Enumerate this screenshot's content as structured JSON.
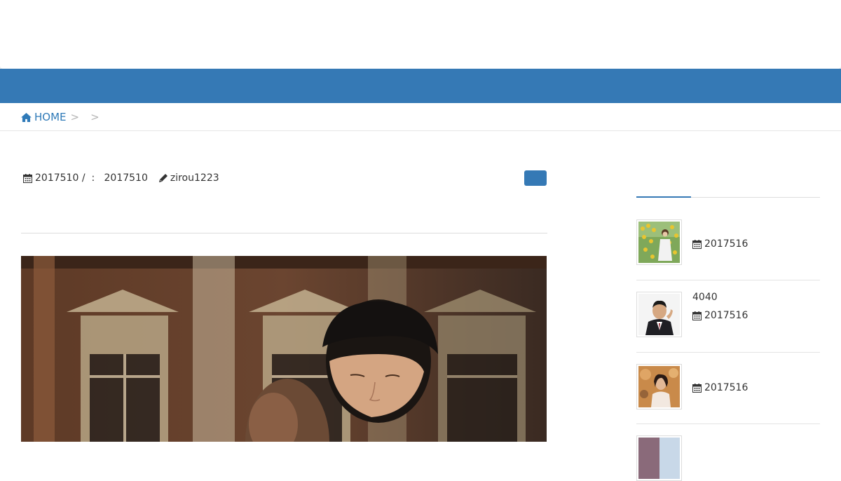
{
  "breadcrumb": {
    "home_label": "HOME",
    "separator": ">"
  },
  "post_meta": {
    "published": "2017510",
    "divider": "/",
    "updated_label": ":",
    "updated": "2017510",
    "author": "zirou1223"
  },
  "sidebar": {
    "items": [
      {
        "title": "",
        "date": "2017516"
      },
      {
        "title": "4040",
        "date": "2017516"
      },
      {
        "title": "",
        "date": "2017516"
      }
    ]
  },
  "colors": {
    "nav": "#3579b5",
    "link": "#2f7ab8"
  },
  "icons": {
    "home": "home-icon",
    "calendar": "calendar-icon",
    "pencil": "pencil-icon"
  }
}
